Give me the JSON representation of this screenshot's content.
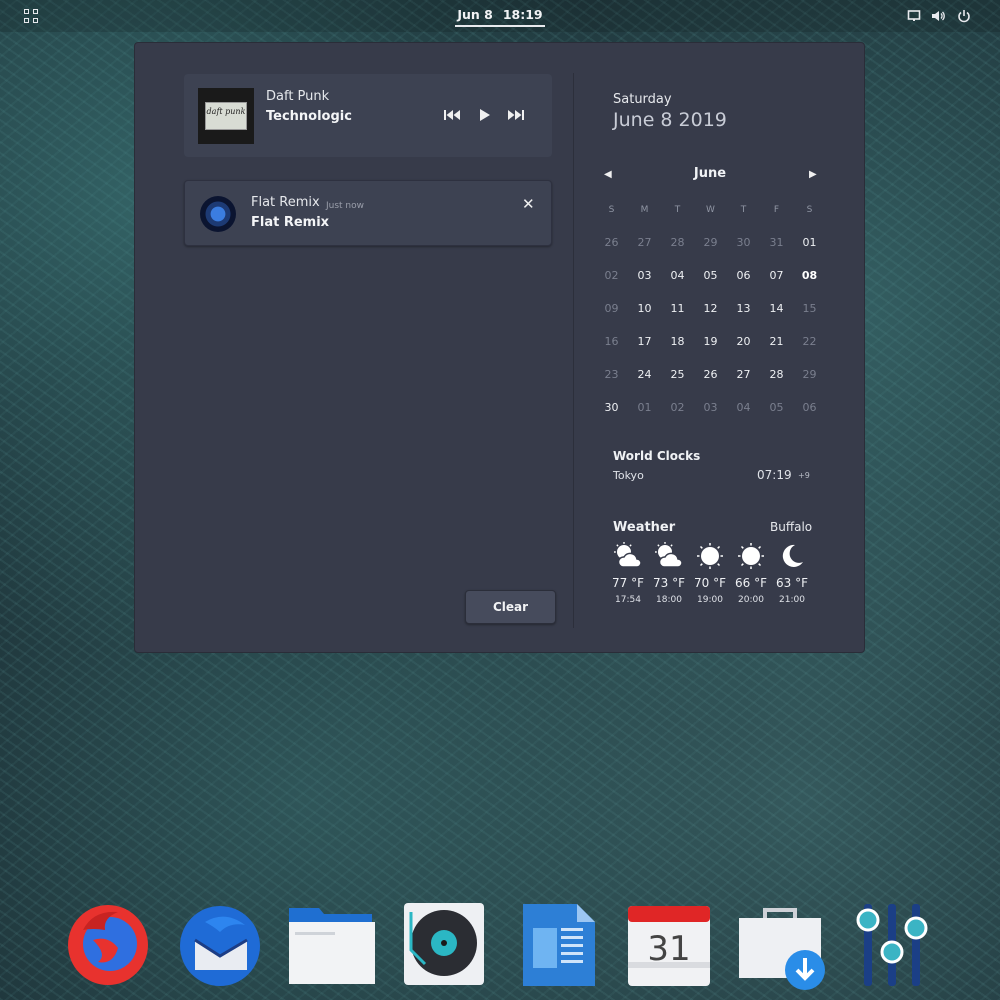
{
  "topbar": {
    "clock_date": "Jun 8",
    "clock_time": "18:19"
  },
  "media": {
    "artist": "Daft Punk",
    "track": "Technologic",
    "album_art_text": "daft punk"
  },
  "notification": {
    "app": "Flat Remix",
    "time": "Just now",
    "title": "Flat Remix"
  },
  "clear_label": "Clear",
  "calendar": {
    "weekday": "Saturday",
    "date": "June 8 2019",
    "month": "June",
    "day_headers": [
      "S",
      "M",
      "T",
      "W",
      "T",
      "F",
      "S"
    ],
    "weeks": [
      [
        {
          "d": "26",
          "dim": true
        },
        {
          "d": "27",
          "dim": true
        },
        {
          "d": "28",
          "dim": true
        },
        {
          "d": "29",
          "dim": true
        },
        {
          "d": "30",
          "dim": true
        },
        {
          "d": "31",
          "dim": true
        },
        {
          "d": "01"
        }
      ],
      [
        {
          "d": "02",
          "dim": true
        },
        {
          "d": "03"
        },
        {
          "d": "04"
        },
        {
          "d": "05"
        },
        {
          "d": "06"
        },
        {
          "d": "07"
        },
        {
          "d": "08",
          "today": true
        }
      ],
      [
        {
          "d": "09",
          "dim": true
        },
        {
          "d": "10"
        },
        {
          "d": "11"
        },
        {
          "d": "12"
        },
        {
          "d": "13"
        },
        {
          "d": "14"
        },
        {
          "d": "15",
          "dim": true
        }
      ],
      [
        {
          "d": "16",
          "dim": true
        },
        {
          "d": "17"
        },
        {
          "d": "18"
        },
        {
          "d": "19"
        },
        {
          "d": "20"
        },
        {
          "d": "21"
        },
        {
          "d": "22",
          "dim": true
        }
      ],
      [
        {
          "d": "23",
          "dim": true
        },
        {
          "d": "24"
        },
        {
          "d": "25"
        },
        {
          "d": "26"
        },
        {
          "d": "27"
        },
        {
          "d": "28"
        },
        {
          "d": "29",
          "dim": true
        }
      ],
      [
        {
          "d": "30"
        },
        {
          "d": "01",
          "dim": true
        },
        {
          "d": "02",
          "dim": true
        },
        {
          "d": "03",
          "dim": true
        },
        {
          "d": "04",
          "dim": true
        },
        {
          "d": "05",
          "dim": true
        },
        {
          "d": "06",
          "dim": true
        }
      ]
    ]
  },
  "world_clocks": {
    "title": "World Clocks",
    "city": "Tokyo",
    "time": "07:19",
    "offset": "+9"
  },
  "weather": {
    "title": "Weather",
    "location": "Buffalo",
    "forecast": [
      {
        "icon": "partly-cloudy-icon",
        "temp": "77 °F",
        "time": "17:54"
      },
      {
        "icon": "partly-cloudy-icon",
        "temp": "73 °F",
        "time": "18:00"
      },
      {
        "icon": "sun-icon",
        "temp": "70 °F",
        "time": "19:00"
      },
      {
        "icon": "sun-icon",
        "temp": "66 °F",
        "time": "20:00"
      },
      {
        "icon": "moon-icon",
        "temp": "63 °F",
        "time": "21:00"
      }
    ]
  },
  "dock": {
    "items": [
      "firefox-icon",
      "thunderbird-icon",
      "files-icon",
      "music-player-icon",
      "libreoffice-writer-icon",
      "calendar-icon",
      "software-install-icon",
      "settings-mixer-icon"
    ],
    "calendar_day": "31"
  },
  "colors": {
    "accent_today": "#1e9e82",
    "panel_bg": "#373b4a",
    "card_bg": "#3d4252"
  }
}
